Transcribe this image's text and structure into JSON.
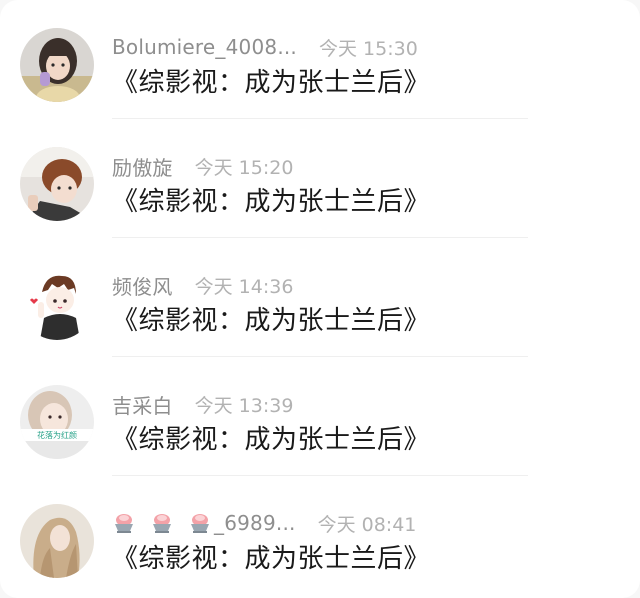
{
  "comments": [
    {
      "name": "Bolumiere_4008...",
      "time": "今天 15:30",
      "text": "《综影视：成为张士兰后》",
      "avatar_desc": "girl-photo-avatar"
    },
    {
      "name": "励傲旋",
      "time": "今天 15:20",
      "text": "《综影视：成为张士兰后》",
      "avatar_desc": "boy-photo-avatar"
    },
    {
      "name": "频俊风",
      "time": "今天 14:36",
      "text": "《综影视：成为张士兰后》",
      "avatar_desc": "cartoon-boy-avatar"
    },
    {
      "name": "吉采白",
      "time": "今天 13:39",
      "text": "《综影视：成为张士兰后》",
      "avatar_desc": "girl-photo-avatar",
      "avatar_text": "花落为红颜"
    },
    {
      "name_emojis": [
        "shaved-ice-emoji",
        "shaved-ice-emoji",
        "shaved-ice-emoji"
      ],
      "name": "_6989...",
      "time": "今天 08:41",
      "text": "《综影视：成为张士兰后》",
      "avatar_desc": "long-hair-photo-avatar"
    }
  ],
  "colors": {
    "name": "#8e8e8e",
    "time": "#b2b2b2",
    "text": "#1a1a1a",
    "background": "#ffffff"
  }
}
